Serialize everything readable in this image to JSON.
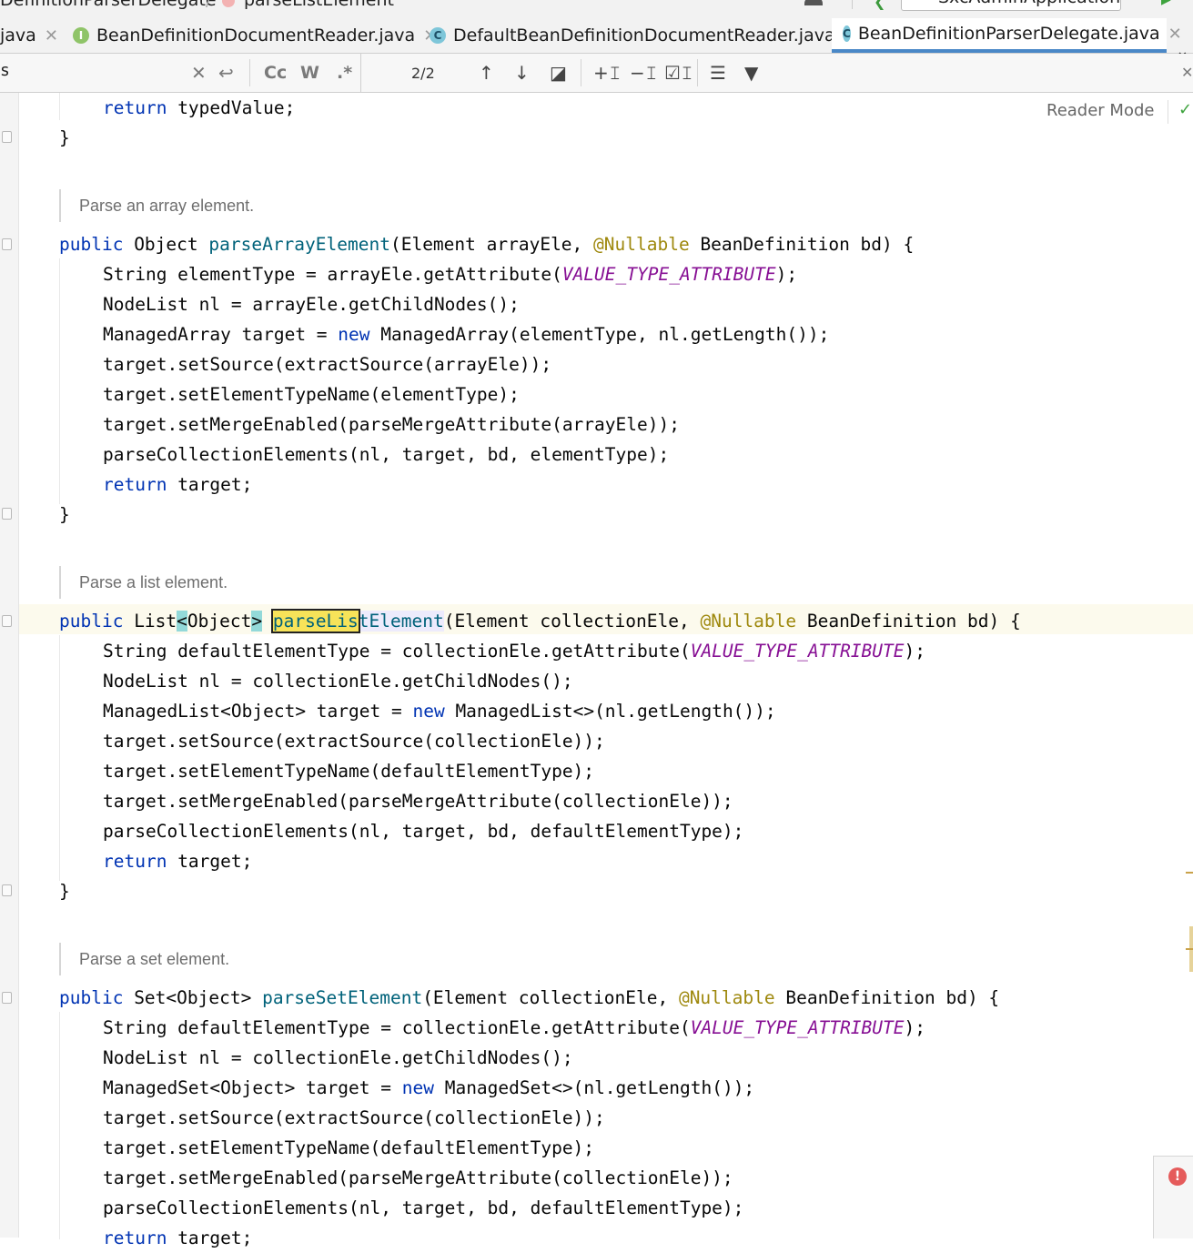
{
  "breadcrumb": {
    "class": "DefinitionParserDelegate",
    "method": "parseListElement"
  },
  "run_config": "SxcAdminApplication",
  "tabs": [
    {
      "label": "java",
      "icon": "none"
    },
    {
      "label": "BeanDefinitionDocumentReader.java",
      "icon": "I"
    },
    {
      "label": "DefaultBeanDefinitionDocumentReader.java",
      "icon": "C"
    },
    {
      "label": "BeanDefinitionParserDelegate.java",
      "icon": "C",
      "active": true
    }
  ],
  "find": {
    "query_prefix": "s",
    "match_counter": "2/2",
    "case_label": "Cc",
    "word_label": "W",
    "regex_label": ".*"
  },
  "reader_mode": "Reader Mode",
  "docs": {
    "array": "Parse an array element.",
    "list": "Parse a list element.",
    "set": "Parse a set element."
  },
  "code": {
    "kw_return": "return",
    "kw_public": "public",
    "kw_new": "new",
    "nullable": "@Nullable",
    "const": "VALUE_TYPE_ATTRIBUTE",
    "l_typed_tail": " typedValue;",
    "close_brace": "}",
    "array_sig_type": " Object ",
    "array_sig_name": "parseArrayElement",
    "array_sig_params": "(Element arrayEle, ",
    "sig_tail": " BeanDefinition bd) {",
    "a1_head": "String elementType = arrayEle.getAttribute(",
    "a1_tail": ");",
    "a2": "NodeList nl = arrayEle.getChildNodes();",
    "a3_head": "ManagedArray target = ",
    "a3_tail": " ManagedArray(elementType, nl.getLength());",
    "a4": "target.setSource(extractSource(arrayEle));",
    "a5": "target.setElementTypeName(elementType);",
    "a6": "target.setMergeEnabled(parseMergeAttribute(arrayEle));",
    "a7": "parseCollectionElements(nl, target, bd, elementType);",
    "ret_tail": " target;",
    "list_sig_a": " List",
    "lt": "<",
    "obj": "Object",
    "gt": ">",
    "list_match": "parseLis",
    "list_rest": "tElement",
    "list_params": "(Element collectionEle, ",
    "c1_head": "String defaultElementType = collectionEle.getAttribute(",
    "c2": "NodeList nl = collectionEle.getChildNodes();",
    "l3_head": "ManagedList<Object> target = ",
    "l3_tail": " ManagedList<>(nl.getLength());",
    "c4": "target.setSource(extractSource(collectionEle));",
    "c5": "target.setElementTypeName(defaultElementType);",
    "c6": "target.setMergeEnabled(parseMergeAttribute(collectionEle));",
    "c7": "parseCollectionElements(nl, target, bd, defaultElementType);",
    "set_sig_type": " Set<Object> ",
    "set_sig_name": "parseSetElement",
    "s3_head": "ManagedSet<Object> target = ",
    "s3_tail": " ManagedSet<>(nl.getLength());"
  }
}
